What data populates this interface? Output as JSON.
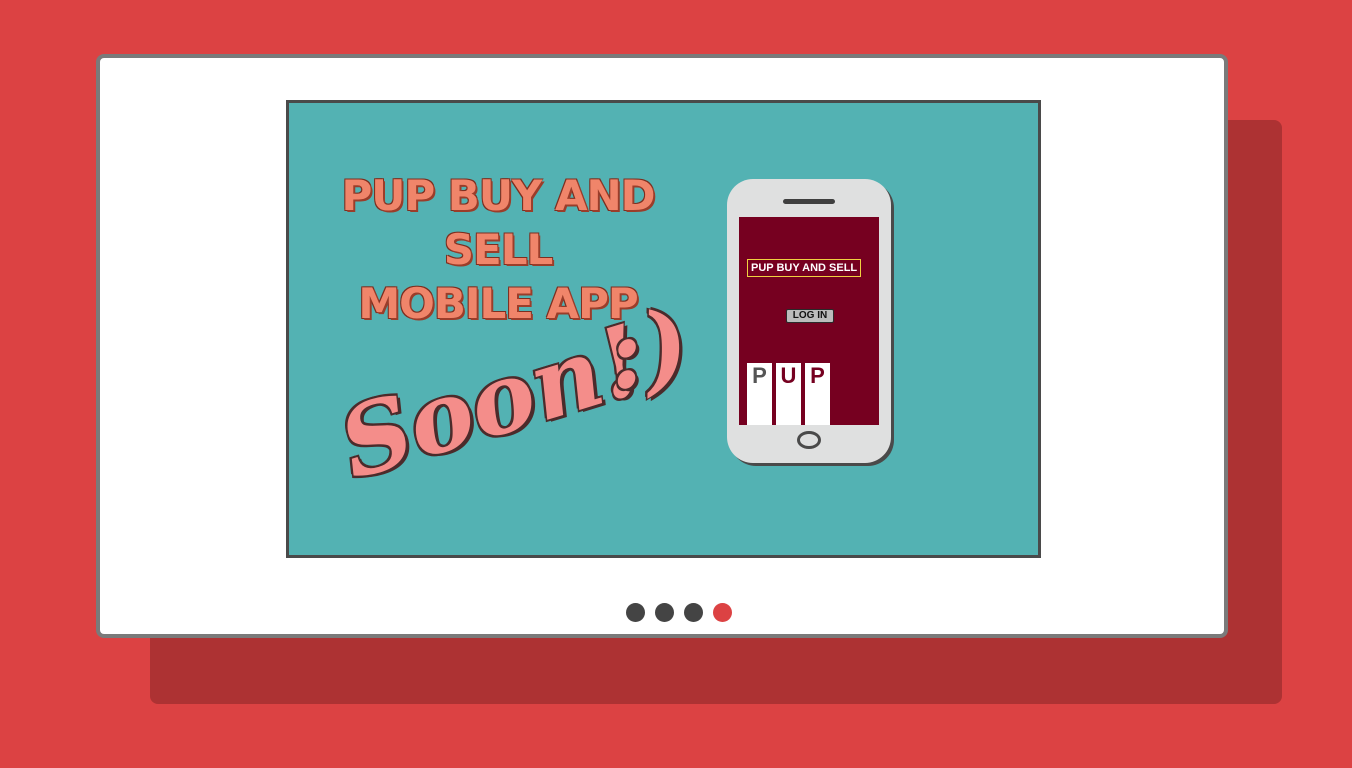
{
  "slide": {
    "headline_line1": "PUP BUY AND SELL",
    "headline_line2": "MOBILE APP",
    "soon_text": "Soon!",
    "smiley_text": ":)"
  },
  "phone": {
    "app_title": "PUP BUY AND SELL",
    "login_label": "LOG IN",
    "logo_letters": [
      "P",
      "U",
      "P"
    ]
  },
  "pager": {
    "total": 4,
    "active_index": 3,
    "dot_color": "#444444",
    "active_color": "#dc4243"
  },
  "colors": {
    "background": "#dc4243",
    "slide_background": "#53b2b3",
    "app_screen": "#760020"
  }
}
